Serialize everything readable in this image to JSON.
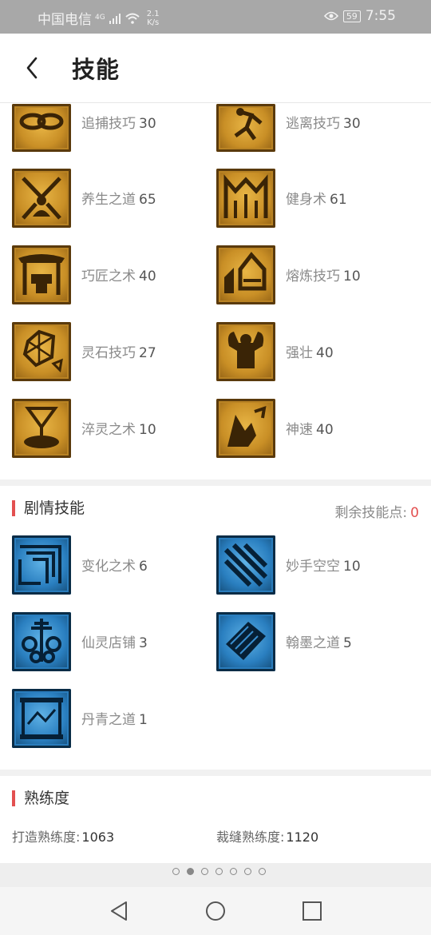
{
  "status_bar": {
    "carrier": "中国电信",
    "network": "4G",
    "speed_value": "2.1",
    "speed_unit": "K/s",
    "battery": "59",
    "time": "7:55"
  },
  "header": {
    "title": "技能"
  },
  "life_skills": [
    {
      "name": "追捕技巧",
      "level": "30",
      "icon": "binding-icon"
    },
    {
      "name": "逃离技巧",
      "level": "30",
      "icon": "running-man-icon"
    },
    {
      "name": "养生之道",
      "level": "65",
      "icon": "meditation-icon"
    },
    {
      "name": "健身术",
      "level": "61",
      "icon": "arches-icon"
    },
    {
      "name": "巧匠之术",
      "level": "40",
      "icon": "anvil-gate-icon"
    },
    {
      "name": "熔炼技巧",
      "level": "10",
      "icon": "furnace-icon"
    },
    {
      "name": "灵石技巧",
      "level": "27",
      "icon": "gem-icon"
    },
    {
      "name": "强壮",
      "level": "40",
      "icon": "strongman-icon"
    },
    {
      "name": "淬灵之术",
      "level": "10",
      "icon": "cauldron-icon"
    },
    {
      "name": "神速",
      "level": "40",
      "icon": "wind-runner-icon"
    }
  ],
  "story_section": {
    "title": "剧情技能",
    "remaining_label": "剩余技能点:",
    "remaining_value": "0"
  },
  "story_skills": [
    {
      "name": "变化之术",
      "level": "6",
      "icon": "maze-icon"
    },
    {
      "name": "妙手空空",
      "level": "10",
      "icon": "claw-slash-icon"
    },
    {
      "name": "仙灵店铺",
      "level": "3",
      "icon": "shop-lantern-icon"
    },
    {
      "name": "翰墨之道",
      "level": "5",
      "icon": "book-icon"
    },
    {
      "name": "丹青之道",
      "level": "1",
      "icon": "scroll-painting-icon"
    }
  ],
  "proficiency": {
    "title": "熟练度",
    "forge_label": "打造熟练度:",
    "forge_value": "1063",
    "tailor_label": "裁缝熟练度:",
    "tailor_value": "1120"
  },
  "pager": {
    "count": 7,
    "active_index": 1
  },
  "colors": {
    "accent": "#e35050",
    "gold_icon": "#c98f26",
    "blue_icon": "#2a7fc0"
  }
}
